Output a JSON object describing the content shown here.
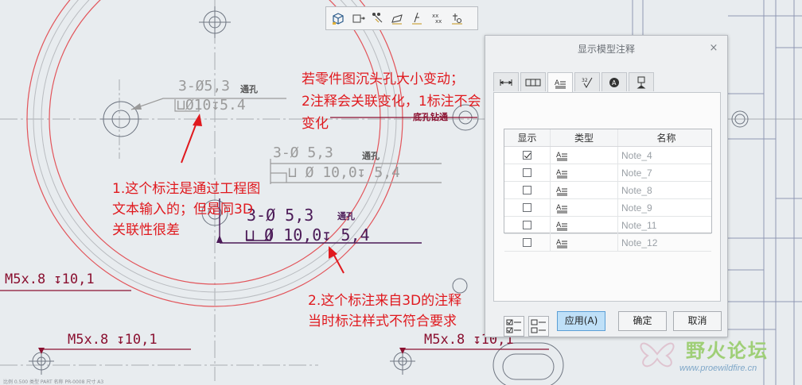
{
  "toolbar": {
    "icons": [
      "cube-icon",
      "show-axes-icon",
      "dimension-icon",
      "geometric-tolerance-icon",
      "surface-finish-icon",
      "datum-icon",
      "note-icon"
    ]
  },
  "drawing": {
    "dim_grey_1a": "3-Ø5,3",
    "dim_grey_1a_cn": "通孔",
    "dim_grey_1b": "⊔Ø10↧5.4",
    "dim_grey_2a": "3-Ø 5,3",
    "dim_grey_2a_cn": "通孔",
    "dim_grey_2b": "⊔ Ø 10,0↧ 5,4",
    "dim_purple_a": "3-Ø 5,3",
    "dim_purple_a_cn": "通孔",
    "dim_purple_b": "⊔ Ø 10,0↧ 5,4",
    "thread_1": "M5x.8 ↧10,1",
    "thread_2": "M5x.8 ↧10,1",
    "thread_3": "M5x.8 ↧10,1",
    "chamfer_label": "底孔钻通",
    "status_bar": "比例 0.500  类型 PART  名称 PR-0008  尺寸 A3"
  },
  "annotations": {
    "top_line1": "若零件图沉头孔大小变动；",
    "top_line2": "2注释会关联变化，1标注不会",
    "top_line3": "变化",
    "left_line1": "1.这个标注是通过工程图",
    "left_line2": "文本输入的；但是同3D",
    "left_line3": "关联性很差",
    "bottom_line1": "2.这个标注来自3D的注释",
    "bottom_line2": "当时标注样式不符合要求"
  },
  "dialog": {
    "title": "显示模型注释",
    "close": "×",
    "tabs": [
      "dimension-tab-icon",
      "gtol-tab-icon",
      "note-tab-icon",
      "surface-finish-tab-icon",
      "symbol-tab-icon",
      "datum-tab-icon"
    ],
    "columns": {
      "show": "显示",
      "type": "类型",
      "name": "名称"
    },
    "rows": [
      {
        "checked": true,
        "type_icon": "note-icon",
        "name": "Note_4"
      },
      {
        "checked": false,
        "type_icon": "note-icon",
        "name": "Note_7"
      },
      {
        "checked": false,
        "type_icon": "note-icon",
        "name": "Note_8"
      },
      {
        "checked": false,
        "type_icon": "note-icon",
        "name": "Note_9"
      },
      {
        "checked": false,
        "type_icon": "note-icon",
        "name": "Note_11"
      },
      {
        "checked": false,
        "type_icon": "note-icon",
        "name": "Note_12"
      }
    ],
    "apply": "应用(A)",
    "ok": "确定",
    "cancel": "取消"
  },
  "watermark": {
    "name": "野火论坛",
    "url": "www.proewildfire.cn"
  },
  "colors": {
    "annotation": "#e0191e",
    "purple_dim": "#4b1a57",
    "maroon_dim": "#8a1030",
    "drawing_line": "#9a9a9a",
    "apply_button": "#bfe0f8"
  }
}
